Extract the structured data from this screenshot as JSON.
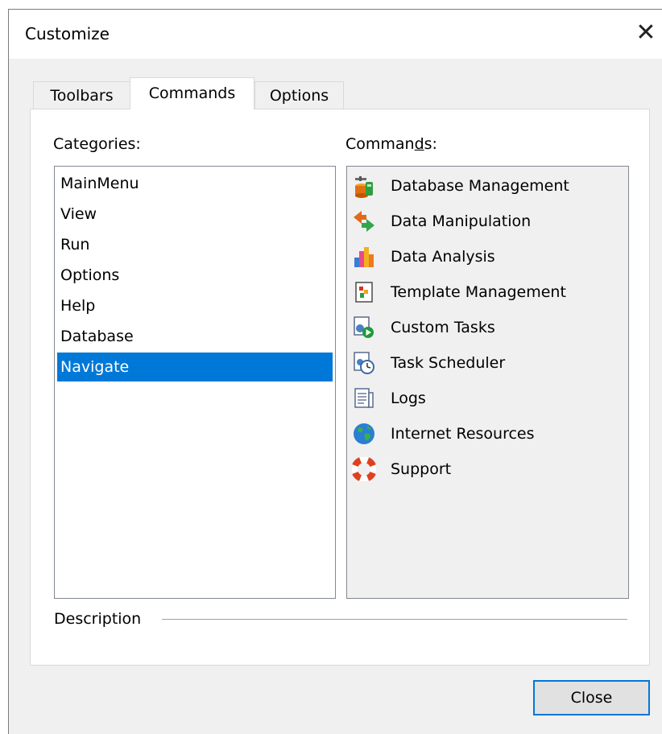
{
  "window": {
    "title": "Customize"
  },
  "tabs": [
    {
      "label": "Toolbars",
      "active": false
    },
    {
      "label": "Commands",
      "active": true
    },
    {
      "label": "Options",
      "active": false
    }
  ],
  "categories": {
    "label_pre": "Cate",
    "label_accel": "g",
    "label_post": "ories:",
    "items": [
      "MainMenu",
      "View",
      "Run",
      "Options",
      "Help",
      "Database",
      "Navigate"
    ],
    "selected": "Navigate"
  },
  "commands": {
    "label_pre": "Comman",
    "label_accel": "d",
    "label_post": "s:",
    "items": [
      {
        "label": "Database Management",
        "icon": "database-management-icon"
      },
      {
        "label": "Data Manipulation",
        "icon": "data-manipulation-icon"
      },
      {
        "label": "Data Analysis",
        "icon": "data-analysis-icon"
      },
      {
        "label": "Template Management",
        "icon": "template-management-icon"
      },
      {
        "label": "Custom Tasks",
        "icon": "custom-tasks-icon"
      },
      {
        "label": "Task Scheduler",
        "icon": "task-scheduler-icon"
      },
      {
        "label": "Logs",
        "icon": "logs-icon"
      },
      {
        "label": "Internet Resources",
        "icon": "globe-icon"
      },
      {
        "label": "Support",
        "icon": "lifebuoy-icon"
      }
    ]
  },
  "description": {
    "label": "Description"
  },
  "buttons": {
    "close": "Close"
  },
  "colors": {
    "selection": "#0078d7",
    "focus_border": "#0078d7"
  }
}
